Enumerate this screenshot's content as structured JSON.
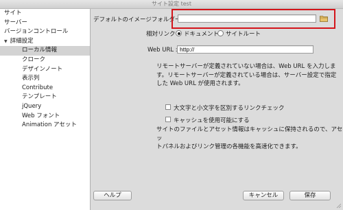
{
  "window": {
    "title": "サイト設定 test"
  },
  "sidebar": {
    "items": [
      {
        "label": "サイト"
      },
      {
        "label": "サーバー"
      },
      {
        "label": "バージョンコントロール"
      },
      {
        "label": "詳細設定"
      },
      {
        "label": "ローカル情報"
      },
      {
        "label": "クローク"
      },
      {
        "label": "デザインノート"
      },
      {
        "label": "表示列"
      },
      {
        "label": "Contribute"
      },
      {
        "label": "テンプレート"
      },
      {
        "label": "jQuery"
      },
      {
        "label": "Web フォント"
      },
      {
        "label": "Animation アセット"
      }
    ]
  },
  "form": {
    "default_image_folder_label": "デフォルトのイメージフォルダー :",
    "default_image_folder_value": "",
    "relative_link_label": "相対リンク :",
    "relative_options": [
      {
        "label": "ドキュメント",
        "selected": true
      },
      {
        "label": "サイトルート",
        "selected": false
      }
    ],
    "web_url_label": "Web URL :",
    "web_url_value": "http://",
    "info_text_lines": [
      "リモートサーバーが定義されていない場合は、Web URL を入力しま",
      "す。リモートサーバーが定義されている場合は、サーバー設定で指定",
      "した Web URL が使用されます。"
    ],
    "case_check_label": "大文字と小文字を区別するリンクチェック",
    "case_check_checked": false,
    "cache_check_label": "キャッシュを使用可能にする",
    "cache_check_checked": false,
    "cache_text_lines": [
      "サイトのファイルとアセット情報はキャッシュに保持されるので、アセッ",
      "トパネルおよびリンク管理の各機能を高速化できます。"
    ]
  },
  "buttons": {
    "help": "ヘルプ",
    "cancel": "キャンセル",
    "save": "保存"
  },
  "colors": {
    "highlight": "#d4141a"
  },
  "icons": {
    "browse": "folder-icon",
    "disclosure": "triangle-down-icon"
  }
}
